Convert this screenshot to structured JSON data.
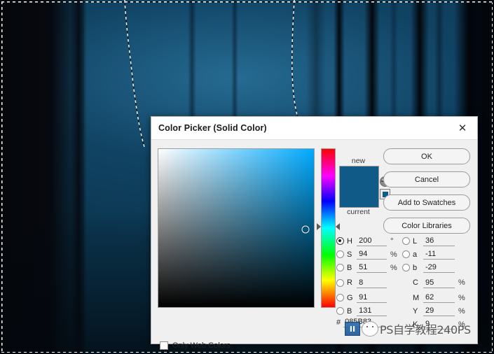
{
  "app": {
    "background_description": "dark blue night forest photo with tree trunks and active selection marching ants"
  },
  "dialog": {
    "title": "Color Picker (Solid Color)",
    "close_icon": "close-icon",
    "preview": {
      "new_label": "new",
      "current_label": "current",
      "new_color": "#0f5a86",
      "current_color": "#0f5a86",
      "gamut_warning_icon": "out-of-gamut-warning-icon",
      "web_safe_icon": "web-safe-cube-icon"
    },
    "buttons": [
      {
        "label": "OK"
      },
      {
        "label": "Cancel"
      },
      {
        "label": "Add to Swatches"
      },
      {
        "label": "Color Libraries"
      }
    ],
    "hsb": [
      {
        "key": "H",
        "value": "200",
        "unit": "°",
        "selected": true
      },
      {
        "key": "S",
        "value": "94",
        "unit": "%",
        "selected": false
      },
      {
        "key": "B",
        "value": "51",
        "unit": "%",
        "selected": false
      }
    ],
    "rgb": [
      {
        "key": "R",
        "value": "8",
        "unit": "",
        "selected": false
      },
      {
        "key": "G",
        "value": "91",
        "unit": "",
        "selected": false
      },
      {
        "key": "B",
        "value": "131",
        "unit": "",
        "selected": false
      }
    ],
    "lab": [
      {
        "key": "L",
        "value": "36",
        "unit": "",
        "selected": false
      },
      {
        "key": "a",
        "value": "-11",
        "unit": "",
        "selected": false
      },
      {
        "key": "b",
        "value": "-29",
        "unit": "",
        "selected": false
      }
    ],
    "cmyk": [
      {
        "key": "C",
        "value": "95",
        "unit": "%"
      },
      {
        "key": "M",
        "value": "62",
        "unit": "%"
      },
      {
        "key": "Y",
        "value": "29",
        "unit": "%"
      },
      {
        "key": "K",
        "value": "9",
        "unit": "%"
      }
    ],
    "hex": {
      "hash": "#",
      "value": "085B83"
    },
    "only_web_colors": {
      "label": "Only Web Colors",
      "checked": false
    },
    "field": {
      "cursor_x_pct": 94.5,
      "cursor_y_pct": 51.0,
      "hue_marker_y_pct": 49.0
    }
  },
  "watermark": {
    "text": "PS自学教程240PS"
  }
}
